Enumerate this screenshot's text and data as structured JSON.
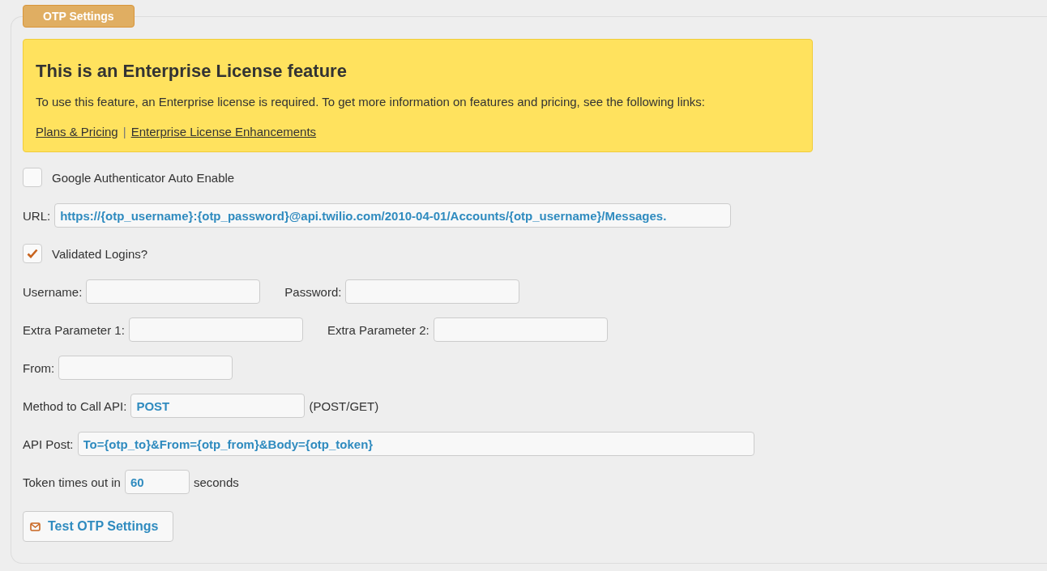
{
  "panel": {
    "legend": "OTP Settings"
  },
  "notice": {
    "title": "This is an Enterprise License feature",
    "text": "To use this feature, an Enterprise license is required. To get more information on features and pricing, see the following links:",
    "links": [
      "Plans & Pricing",
      "Enterprise License Enhancements"
    ],
    "separator": "|"
  },
  "rows": [
    {
      "kind": "checkbox",
      "label": "Google Authenticator Auto Enable",
      "checked": false
    },
    {
      "kind": "fields",
      "fields": [
        {
          "label": "URL:",
          "value": "https://{otp_username}:{otp_password}@api.twilio.com/2010-04-01/Accounts/{otp_username}/Messages."
        }
      ]
    },
    {
      "kind": "checkbox",
      "label": "Validated Logins?",
      "checked": true
    },
    {
      "kind": "fields",
      "fields": [
        {
          "label": "Username:"
        },
        {
          "label": "Password:"
        }
      ]
    },
    {
      "kind": "fields",
      "fields": [
        {
          "label": "Extra Parameter 1:"
        },
        {
          "label": "Extra Parameter 2:"
        }
      ]
    },
    {
      "kind": "fields",
      "fields": [
        {
          "label": "From:"
        }
      ]
    },
    {
      "kind": "fields",
      "fields": [
        {
          "label": "Method to Call API:",
          "value": "POST",
          "suffix": "(POST/GET)"
        }
      ]
    },
    {
      "kind": "fields",
      "fields": [
        {
          "label": "API Post:",
          "value": "To={otp_to}&From={otp_from}&Body={otp_token}"
        }
      ]
    },
    {
      "kind": "fields",
      "fields": [
        {
          "label": "Token times out in",
          "value": "60",
          "suffix": "seconds"
        }
      ]
    },
    {
      "kind": "button",
      "label": "Test OTP Settings"
    }
  ]
}
